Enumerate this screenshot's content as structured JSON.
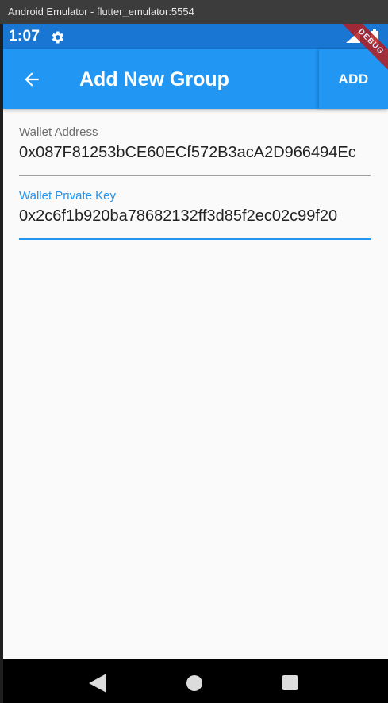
{
  "window": {
    "title": "Android Emulator - flutter_emulator:5554"
  },
  "status_bar": {
    "time": "1:07",
    "icons": [
      "gear-icon",
      "signal-icon",
      "battery-icon"
    ],
    "color": "#1976d2"
  },
  "app_bar": {
    "title": "Add New Group",
    "back_icon": "arrow-left-icon",
    "action_label": "ADD",
    "color": "#2196f3"
  },
  "debug_banner": {
    "label": "DEBUG"
  },
  "form": {
    "wallet_address": {
      "label": "Wallet Address",
      "value": "0x087F81253bCE60ECf572B3acA2D966494Ec"
    },
    "wallet_private_key": {
      "label": "Wallet Private Key",
      "value": "0x2c6f1b920ba78682132ff3d85f2ec02c99f20",
      "focused": true,
      "accent": "#2196f3"
    }
  },
  "nav_bar": {
    "icons": [
      "nav-back-icon",
      "nav-home-icon",
      "nav-recents-icon"
    ]
  }
}
